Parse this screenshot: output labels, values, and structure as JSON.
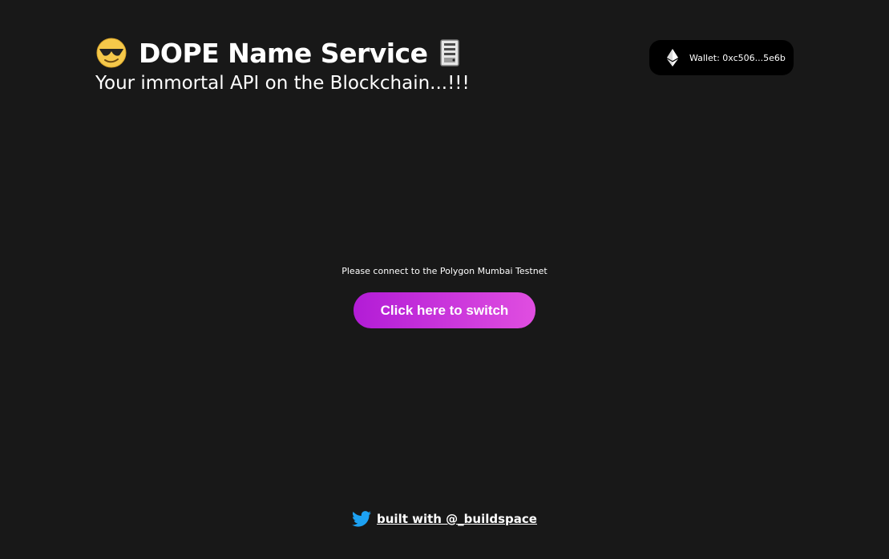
{
  "header": {
    "title": "DOPE Name Service",
    "subtitle": "Your immortal API on the Blockchain...!!!",
    "leading_icon": "sunglasses-face-icon",
    "trailing_icon": "server-icon"
  },
  "wallet": {
    "icon": "ethereum-icon",
    "label": "Wallet: 0xc506...5e6b"
  },
  "network_prompt": {
    "message": "Please connect to the Polygon Mumbai Testnet",
    "button_label": "Click here to switch"
  },
  "footer": {
    "icon": "twitter-icon",
    "link_text": "built with @_buildspace"
  },
  "colors": {
    "background": "#181818",
    "button_gradient_start": "#b21cd6",
    "button_gradient_end": "#e04ee0",
    "twitter_blue": "#1da1f2",
    "wallet_background": "#000000"
  }
}
